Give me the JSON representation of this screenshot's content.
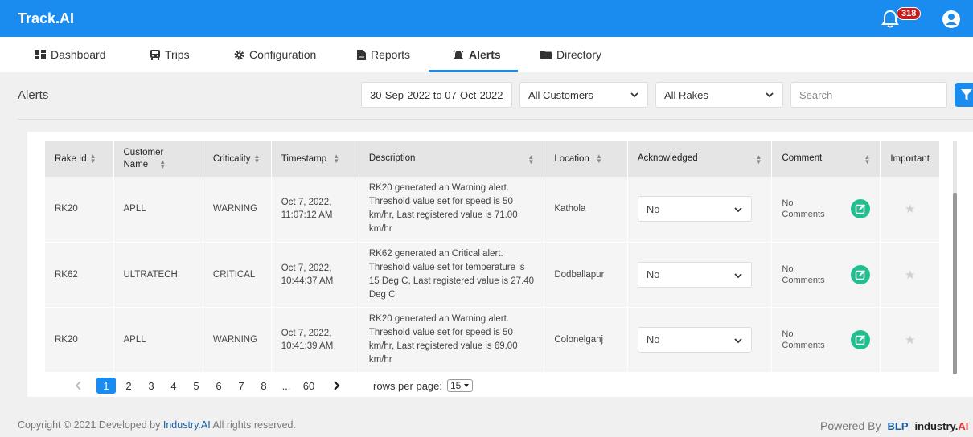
{
  "app": {
    "brand": "Track.AI",
    "notification_count": "318"
  },
  "nav": {
    "items": [
      {
        "label": "Dashboard",
        "icon": "dashboard-icon"
      },
      {
        "label": "Trips",
        "icon": "trips-icon"
      },
      {
        "label": "Configuration",
        "icon": "gear-icon"
      },
      {
        "label": "Reports",
        "icon": "report-icon"
      },
      {
        "label": "Alerts",
        "icon": "alert-icon"
      },
      {
        "label": "Directory",
        "icon": "folder-icon"
      }
    ],
    "active": "Alerts"
  },
  "page": {
    "title": "Alerts"
  },
  "filters": {
    "date_range": "30-Sep-2022 to 07-Oct-2022",
    "customers": "All Customers",
    "rakes": "All Rakes",
    "search_placeholder": "Search"
  },
  "table": {
    "headers": {
      "rake_id": "Rake Id",
      "customer_line1": "Customer",
      "customer_line2": "Name",
      "criticality": "Criticality",
      "timestamp": "Timestamp",
      "description": "Description",
      "location": "Location",
      "acknowledged": "Acknowledged",
      "comment": "Comment",
      "important": "Important"
    },
    "rows": [
      {
        "rake_id": "RK20",
        "customer": "APLL",
        "criticality": "WARNING",
        "ts_line1": "Oct 7, 2022,",
        "ts_line2": "11:07:12 AM",
        "description": "RK20 generated an Warning alert. Threshold value set for speed is 50 km/hr, Last registered value is 71.00 km/hr",
        "location": "Kathola",
        "acknowledged": "No",
        "comment_line1": "No",
        "comment_line2": "Comments"
      },
      {
        "rake_id": "RK62",
        "customer": "ULTRATECH",
        "criticality": "CRITICAL",
        "ts_line1": "Oct 7, 2022,",
        "ts_line2": "10:44:37 AM",
        "description": "RK62 generated an Critical alert. Threshold value set for temperature is 15 Deg C, Last registered value is 27.40 Deg C",
        "location": "Dodballapur",
        "acknowledged": "No",
        "comment_line1": "No",
        "comment_line2": "Comments"
      },
      {
        "rake_id": "RK20",
        "customer": "APLL",
        "criticality": "WARNING",
        "ts_line1": "Oct 7, 2022,",
        "ts_line2": "10:41:39 AM",
        "description": "RK20 generated an Warning alert. Threshold value set for speed is 50 km/hr, Last registered value is 69.00 km/hr",
        "location": "Colonelganj",
        "acknowledged": "No",
        "comment_line1": "No",
        "comment_line2": "Comments"
      }
    ]
  },
  "pagination": {
    "pages": [
      "1",
      "2",
      "3",
      "4",
      "5",
      "6",
      "7",
      "8",
      "...",
      "60"
    ],
    "current": "1",
    "rows_label": "rows per page:",
    "rows_value": "15"
  },
  "footer": {
    "copyright_pre": "Copyright © 2021 Developed by ",
    "company": "Industry.AI",
    "copyright_post": " All rights reserved.",
    "powered_by": "Powered By",
    "logo_blp": "BLP",
    "logo_industry": "industry.",
    "logo_ai": "AI"
  },
  "colors": {
    "primary": "#1a8cf0",
    "badge": "#c81d1d",
    "edit_button": "#1fbf8f"
  }
}
